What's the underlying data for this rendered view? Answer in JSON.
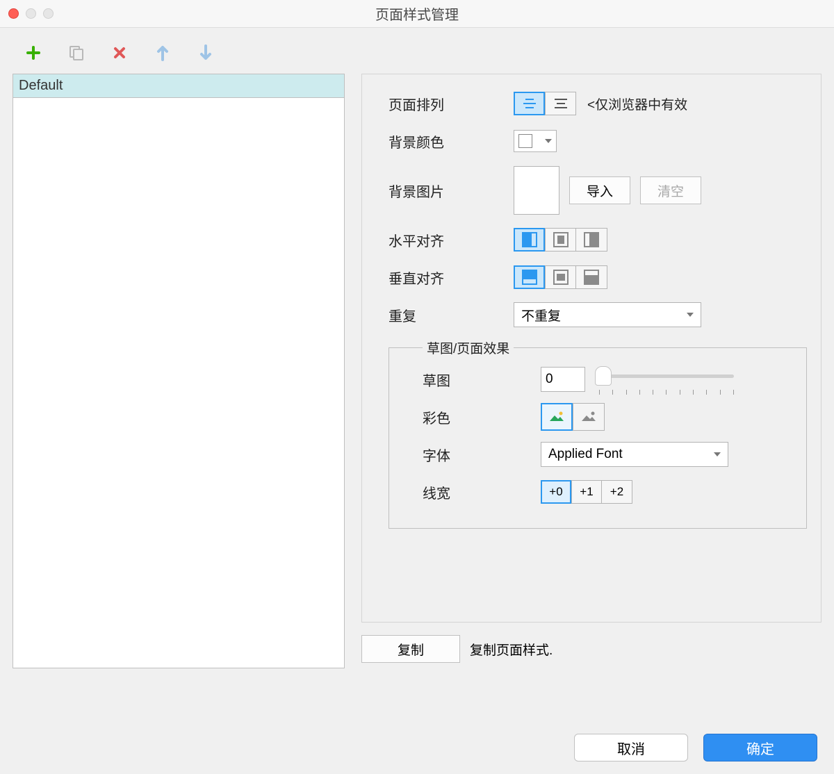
{
  "window": {
    "title": "页面样式管理"
  },
  "toolbar_icons": {
    "add": "add-icon",
    "copy": "copy-icon",
    "delete": "delete-icon",
    "up": "arrow-up-icon",
    "down": "arrow-down-icon"
  },
  "style_list": {
    "items": [
      "Default"
    ],
    "selected": 0
  },
  "labels": {
    "page_arrange": "页面排列",
    "arrange_hint": "<仅浏览器中有效",
    "bg_color": "背景颜色",
    "bg_image": "背景图片",
    "import": "导入",
    "clear": "清空",
    "h_align": "水平对齐",
    "v_align": "垂直对齐",
    "repeat": "重复",
    "fx_legend": "草图/页面效果",
    "sketch": "草图",
    "color": "彩色",
    "font": "字体",
    "line_width": "线宽",
    "copy_btn": "复制",
    "copy_desc": "复制页面样式.",
    "cancel": "取消",
    "ok": "确定"
  },
  "values": {
    "repeat_selected": "不重复",
    "sketch_value": "0",
    "font_selected": "Applied Font",
    "line_widths": [
      "+0",
      "+1",
      "+2"
    ],
    "line_width_selected": 0,
    "page_arrange_selected": 0,
    "h_align_selected": 0,
    "v_align_selected": 0,
    "color_mode_selected": 0
  }
}
